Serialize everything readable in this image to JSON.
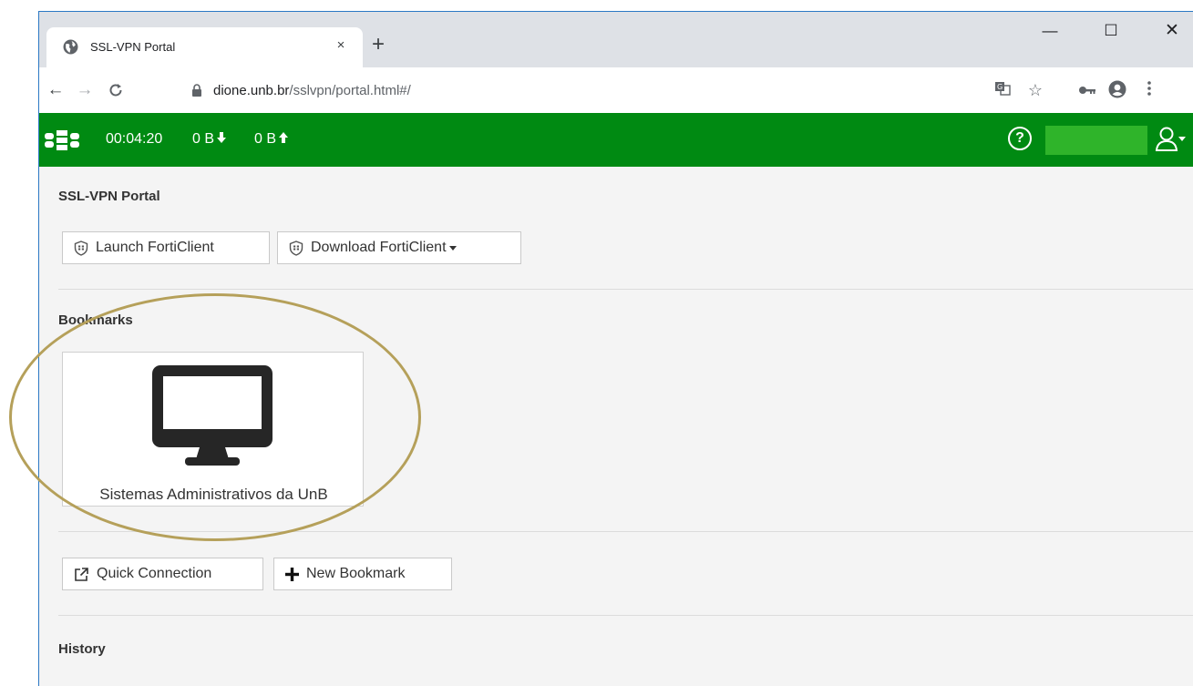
{
  "browser": {
    "tab": {
      "title": "SSL-VPN Portal",
      "close": "×"
    },
    "new_tab": "+",
    "window_controls": {
      "minimize": "—",
      "maximize": "☐",
      "close": "✕"
    },
    "nav": {
      "back": "←",
      "forward": "→",
      "reload": "C"
    },
    "address": {
      "host": "dione.unb.br",
      "path": "/sslvpn/portal.html#/"
    },
    "toolbar_icons": [
      "translate-icon",
      "star-icon",
      "key-icon",
      "profile-icon",
      "menu-icon"
    ]
  },
  "header": {
    "session_time": "00:04:20",
    "bytes_down": "0 B",
    "bytes_up": "0 B",
    "help": "?",
    "brand_color": "#008a12"
  },
  "portal": {
    "title": "SSL-VPN Portal",
    "launch_label": "Launch FortiClient",
    "download_label": "Download FortiClient"
  },
  "bookmarks": {
    "title": "Bookmarks",
    "items": [
      {
        "label": "Sistemas Administrativos da UnB",
        "icon": "monitor-icon"
      }
    ],
    "quick_connection_label": "Quick Connection",
    "new_bookmark_label": "New Bookmark"
  },
  "history": {
    "title": "History"
  }
}
